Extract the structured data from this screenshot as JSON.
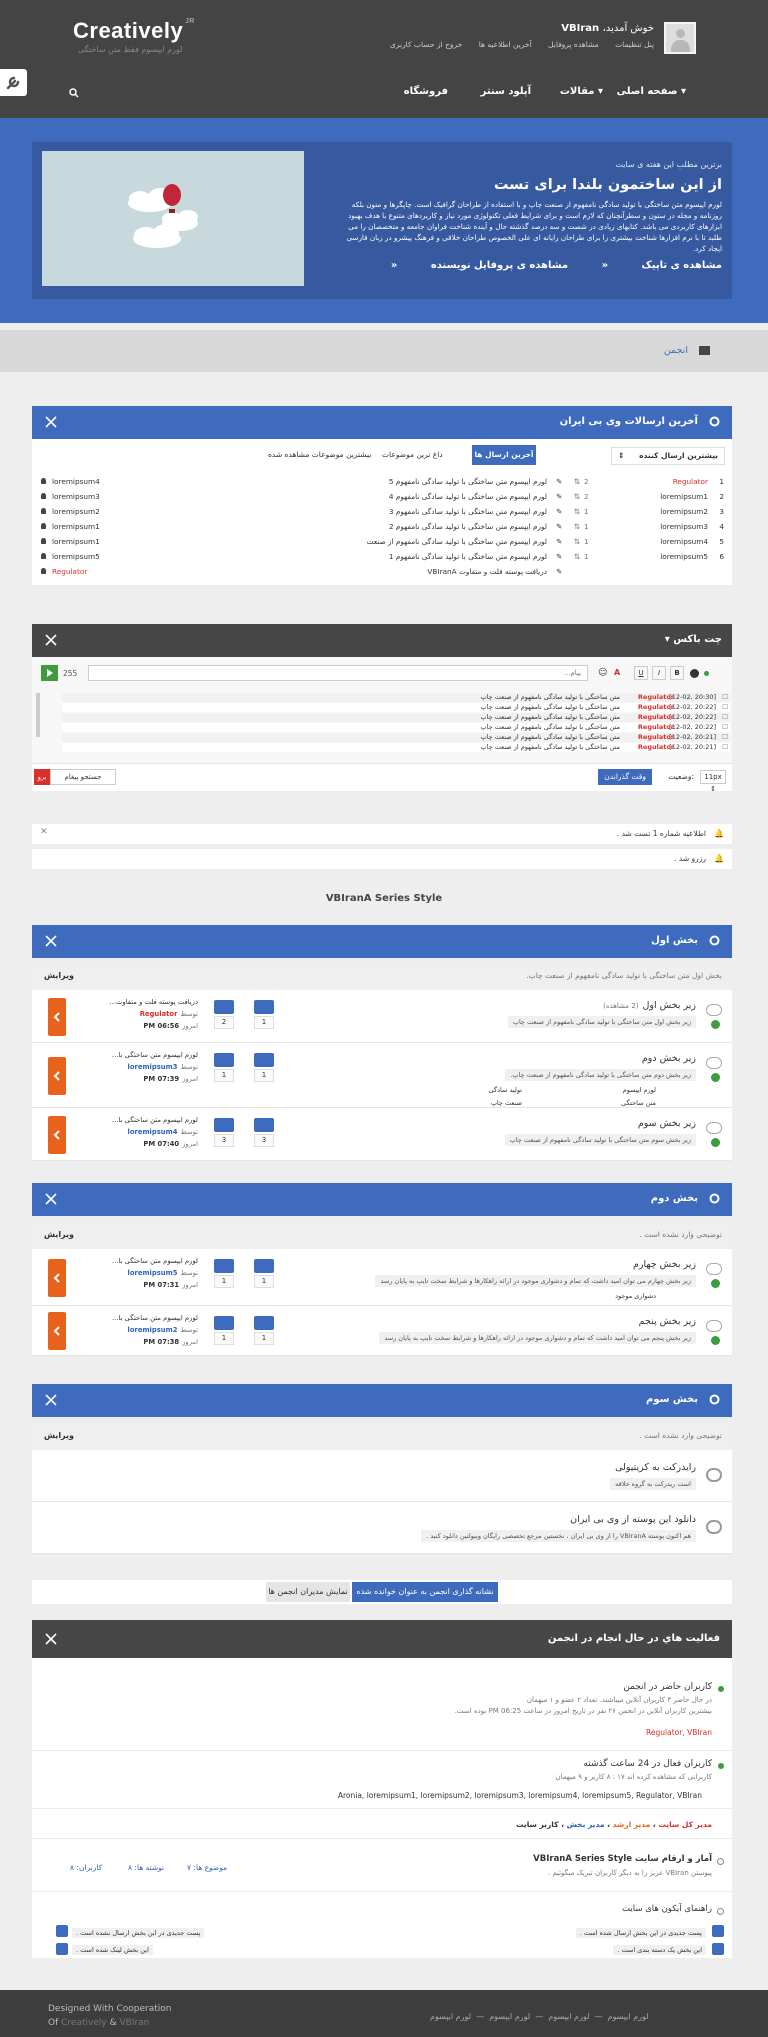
{
  "header": {
    "logo": "Creatively",
    "logo_sup": "JR",
    "slogan": "لورم ایپسوم فقط متن ساختگی",
    "welcome_prefix": "خوش آمدید،",
    "username": "VBIran",
    "user_links": [
      "پنل تنظیمات",
      "مشاهده پروفایل",
      "آخرین اطلاعیه ها",
      "خروج از حساب کاربری"
    ],
    "nav": [
      "صفحه اصلی",
      "مقالات",
      "آپلود سنتر",
      "فروشگاه"
    ]
  },
  "feature": {
    "kicker": "برترین مطلب این هفته ی سایت",
    "title": "از این ساختمون بلندا برای تست",
    "body": "لورم ایپسوم متن ساختگی با تولید سادگی نامفهوم از صنعت چاپ و با استفاده از طراحان گرافیک است. چاپگرها و متون بلکه روزنامه و مجله در ستون و سطرآنچنان که لازم است و برای شرایط فعلی تکنولوژی مورد نیاز و کاربردهای متنوع با هدف بهبود ابزارهای کاربردی می باشد. کتابهای زیادی در شصت و سه درصد گذشته حال و آینده شناخت فراوان جامعه و متخصصان را می طلبد تا با نرم افزارها شناخت بیشتری را برای طراحان رایانه ای علی الخصوص طراحان خلاقی و فرهنگ پیشرو در زبان فارسی ایجاد کرد.",
    "links": [
      "مشاهده ی تاپیک",
      "مشاهده ی پروفایل نویسنده"
    ]
  },
  "breadcrumb": "انجمن",
  "latest": {
    "title": "آخرین ارسالات وی بی ایران",
    "tabs": [
      "آخرین ارسال ها",
      "داغ ترین موضوعات",
      "بیشترین موضوعات مشاهده شده"
    ],
    "sort_label": "بیشترین ارسال کننده",
    "posters": [
      {
        "rank": "1",
        "name": "Regulator",
        "count": "2",
        "red": true
      },
      {
        "rank": "2",
        "name": "loremipsum1",
        "count": "2",
        "red": false
      },
      {
        "rank": "3",
        "name": "loremipsum2",
        "count": "1",
        "red": false
      },
      {
        "rank": "4",
        "name": "loremipsum3",
        "count": "1",
        "red": false
      },
      {
        "rank": "5",
        "name": "loremipsum4",
        "count": "1",
        "red": false
      },
      {
        "rank": "6",
        "name": "loremipsum5",
        "count": "1",
        "red": false
      }
    ],
    "threads": [
      {
        "title": "لورم ایپسوم متن ساختگی با تولید سادگی نامفهوم 5",
        "author": "loremipsum4",
        "red": false
      },
      {
        "title": "لورم ایپسوم متن ساختگی با تولید سادگی نامفهوم 4",
        "author": "loremipsum3",
        "red": false
      },
      {
        "title": "لورم ایپسوم متن ساختگی با تولید سادگی نامفهوم 3",
        "author": "loremipsum2",
        "red": false
      },
      {
        "title": "لورم ایپسوم متن ساختگی با تولید سادگی نامفهوم 2",
        "author": "loremipsum1",
        "red": false
      },
      {
        "title": "لورم ایپسوم متن ساختگی با تولید سادگی نامفهوم از صنعت",
        "author": "loremipsum1",
        "red": false
      },
      {
        "title": "لورم ایپسوم متن ساختگی با تولید سادگی نامفهوم 1",
        "author": "loremipsum5",
        "red": false
      },
      {
        "title": "دریافت پوسته فلت و متفاوت VBIranA",
        "author": "Regulator",
        "red": true
      }
    ]
  },
  "chat": {
    "title": "چت باکس",
    "placeholder": "پیام...",
    "counter": "255",
    "messages": [
      {
        "time": "[12-02, 20:30]",
        "user": "Regulator",
        "text": "متن ساختگی با تولید سادگی نامفهوم از صنعت چاپ"
      },
      {
        "time": "[12-02, 20:22]",
        "user": "Regulator",
        "text": "متن ساختگی با تولید سادگی نامفهوم از صنعت چاپ"
      },
      {
        "time": "[12-02, 20:22]",
        "user": "Regulator",
        "text": "متن ساختگی با تولید سادگی نامفهوم از صنعت چاپ"
      },
      {
        "time": "[12-02, 20:22]",
        "user": "Regulator",
        "text": "متن ساختگی با تولید سادگی نامفهوم از صنعت چاپ"
      },
      {
        "time": "[12-02, 20:21]",
        "user": "Regulator",
        "text": "متن ساختگی با تولید سادگی نامفهوم از صنعت چاپ"
      },
      {
        "time": "[12-02, 20:21]",
        "user": "Regulator",
        "text": "متن ساختگی با تولید سادگی نامفهوم از صنعت چاپ"
      }
    ],
    "status_label": "وضعیت:",
    "status_value": "وقت گذراندن",
    "font_size": "11px",
    "search_label": "جستجو پیغام",
    "search_btn": "برو"
  },
  "notices": [
    "اطلاعیه شماره 1 تست شد .",
    "رزرو شد ."
  ],
  "series_title": "VBIranA Series Style",
  "sections": [
    {
      "title": "بخش اول",
      "desc": "بخش اول متن ساختگی با تولید سادگی نامفهوم از صنعت چاپ.",
      "edit": "ویرایش",
      "forums": [
        {
          "name": "زیر بخش اول",
          "viewers": "(2 مشاهده)",
          "desc": "زیر بخش اول متن ساختگی با تولید سادگی نامفهوم از صنعت چاپ",
          "subs": [],
          "threads": "1",
          "posts": "2",
          "last_title": "دریافت پوسته فلت و متفاوت...",
          "by": "توسط",
          "last_user": "Regulator",
          "user_red": true,
          "date": "امروز",
          "time": "06:56 PM"
        },
        {
          "name": "زیر بخش دوم",
          "viewers": "",
          "desc": "زیر بخش دوم متن ساختگی با تولید سادگی نامفهوم از صنعت چاپ.",
          "subs": [
            "لورم ایپسوم",
            "تولید سادگی",
            "متن ساختگی",
            "صنعت چاپ"
          ],
          "threads": "1",
          "posts": "1",
          "last_title": "لورم ایپسوم متن ساختگی با...",
          "by": "توسط",
          "last_user": "loremipsum3",
          "user_red": false,
          "date": "امروز",
          "time": "07:39 PM"
        },
        {
          "name": "زیر بخش سوم",
          "viewers": "",
          "desc": "زیر بخش سوم متن ساختگی با تولید سادگی نامفهوم از صنعت چاپ",
          "subs": [],
          "threads": "3",
          "posts": "3",
          "last_title": "لورم ایپسوم متن ساختگی با...",
          "by": "توسط",
          "last_user": "loremipsum4",
          "user_red": false,
          "date": "امروز",
          "time": "07:40 PM"
        }
      ]
    },
    {
      "title": "بخش دوم",
      "desc": "توضیحی وارد نشده است .",
      "edit": "ویرایش",
      "forums": [
        {
          "name": "زیر بخش چهارم",
          "viewers": "",
          "desc": "زیر بخش چهارم می توان امید داشت که تمام و دشواری موجود در ارائه راهکارها و شرایط سخت تایپ به پایان رسد",
          "subs": [
            "دشواری موجود"
          ],
          "threads": "1",
          "posts": "1",
          "last_title": "لورم ایپسوم متن ساختگی با...",
          "by": "توسط",
          "last_user": "loremipsum5",
          "user_red": false,
          "date": "امروز",
          "time": "07:31 PM"
        },
        {
          "name": "زیر بخش پنجم",
          "viewers": "",
          "desc": "زیر بخش پنجم می توان امید داشت که تمام و دشواری موجود در ارائه راهکارها و شرایط سخت تایپ به پایان رسد",
          "subs": [],
          "threads": "1",
          "posts": "1",
          "last_title": "لورم ایپسوم متن ساختگی با...",
          "by": "توسط",
          "last_user": "loremipsum2",
          "user_red": false,
          "date": "امروز",
          "time": "07:38 PM"
        }
      ]
    },
    {
      "title": "بخش سوم",
      "desc": "توضیحی وارد نشده است .",
      "edit": "ویرایش",
      "links": [
        {
          "name": "رایدرکت به کریتیولی",
          "desc": "است ریدرکت به گروه خلاقه"
        },
        {
          "name": "دانلود این پوسته از وی بی ایران",
          "desc": "هم اکنون پوسته VBIranA را از وی بی ایران ، نخستین مرجع تخصصی رایگان ویبولتین دانلود کنید ."
        }
      ]
    }
  ],
  "buttons": {
    "mark_read": "نشانه گذاری انجمن به عنوان خوانده شده",
    "show_mods": "نمایش مدیران انجمن ها"
  },
  "activity": {
    "title": "فعالیت هاي در حال انجام در انجمن",
    "online_title": "کاربران حاضر در انجمن",
    "online_line1": "در حال حاضر ۳ کاربران آنلاین میباشند. تعداد ۲ عضو و ۱ میهمان",
    "online_line2": "بیشترین کاربران آنلاین در انجمن ۲۶ نفر در تاریخ امروز در ساعت 06:25 PM بوده است.",
    "online_users": "Regulator, VBIran",
    "active_title": "کاربران فعال در 24 ساعت گذشته",
    "active_line": "کاربرانی که مشاهده کرده اند ۱۷ : ۸ کاربر و ۹ میهمان",
    "active_users": "Aronia, loremipsum1, loremipsum2, loremipsum3, loremipsum4, loremipsum5, Regulator, VBIran",
    "legend": [
      "مدیر کل سایت",
      "مدیر ارشد",
      "مدیر بخش",
      "کاربر سایت"
    ],
    "stats_title": "آمار و ارقام سایت VBIranA Series Style",
    "stats_line": "پیوستن VBIran عزیز را به دیگر کاربران تبریک میگوئیم .",
    "stat_threads": "موضوع ها: ۷",
    "stat_posts": "نوشته ها: ۸",
    "stat_users": "کاربران: ۸",
    "icons_title": "راهنمای آیکون های سایت",
    "icons": [
      "پست جديدی در اين بخش ارسال شده است .",
      "پست جديدی در اين بخش ارسال نشده است .",
      "اين بخش یک دسته بندی است .",
      "اين بخش لینک شده است ."
    ]
  },
  "footer": {
    "line1": "Designed With Cooperation",
    "line2_of": "Of",
    "line2_creatively": "Creatively",
    "line2_amp": "&",
    "line2_vbiran": "VBIran",
    "links": [
      "لورم ایپسوم",
      "لورم ایپسوم",
      "لورم ایپسوم",
      "لورم ایپسوم"
    ]
  }
}
